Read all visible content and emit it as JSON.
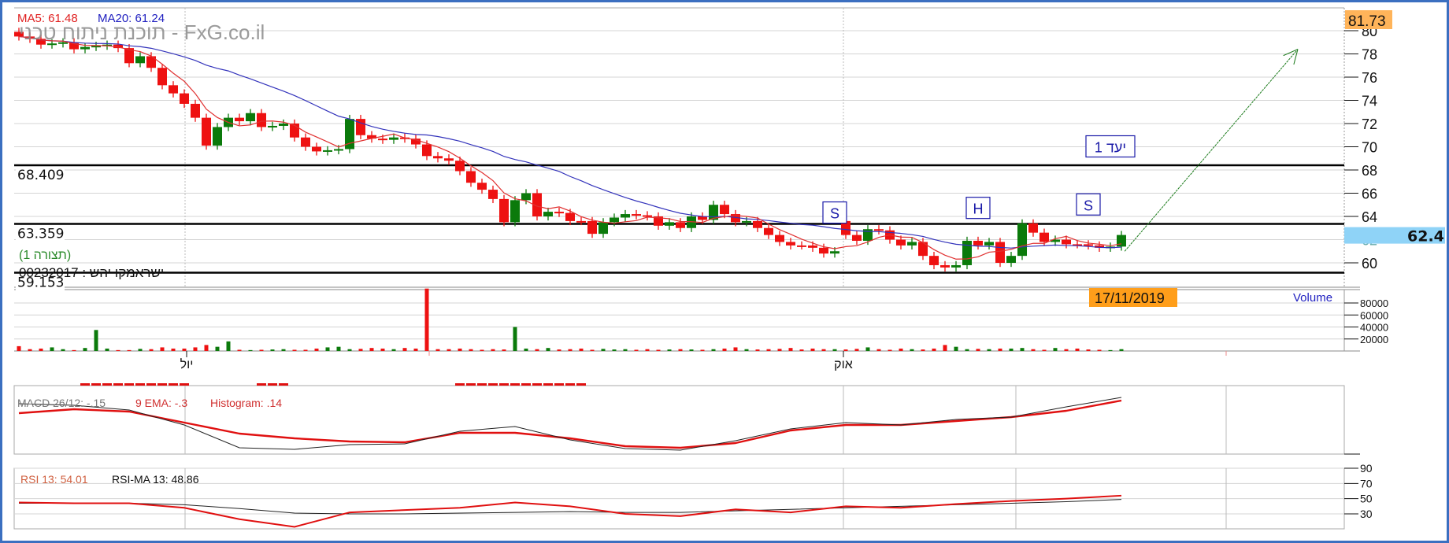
{
  "chart_data": {
    "type": "candlestick",
    "title_watermark": "תוכנת ניתוח טכני - FxG.co.il",
    "symbol_label": "ישראמקו יהש : 00232017",
    "pattern_label": "(תצורה 1)",
    "date_label": "17/11/2019",
    "ma_legend": {
      "ma5": "MA5: 61.48",
      "ma20": "MA20: 61.24"
    },
    "price_axis": {
      "ticks": [
        "80",
        "78",
        "76",
        "74",
        "72",
        "70",
        "68",
        "66",
        "64",
        "62",
        "60"
      ],
      "ylim": [
        58,
        82
      ]
    },
    "high_marker": "81.73",
    "last_price": "62.4",
    "levels": [
      {
        "value": 68.409,
        "label": "68.409"
      },
      {
        "value": 63.359,
        "label": "63.359"
      },
      {
        "value": 59.153,
        "label": "59.153"
      }
    ],
    "annotations": [
      {
        "text": "S",
        "index": 74,
        "price": 64.3
      },
      {
        "text": "H",
        "index": 87,
        "price": 64.7
      },
      {
        "text": "S",
        "index": 97,
        "price": 65.0
      },
      {
        "text": "יעד 1",
        "index": 99,
        "price": 70.0
      }
    ],
    "target_arrow": {
      "from": {
        "index": 100.3,
        "price": 61.0
      },
      "to": {
        "index": 116,
        "price": 78.4
      }
    },
    "x_labels": [
      {
        "text": "יול",
        "index": 15
      },
      {
        "text": "אוק",
        "index": 75
      }
    ],
    "open": [
      79.9,
      79.5,
      79.3,
      78.8,
      78.9,
      79.0,
      78.4,
      78.6,
      78.7,
      78.8,
      78.5,
      77.2,
      77.8,
      76.8,
      75.3,
      74.6,
      73.7,
      72.5,
      70.1,
      71.7,
      72.5,
      72.2,
      72.9,
      71.7,
      71.8,
      72.0,
      70.8,
      70.0,
      69.6,
      69.7,
      69.8,
      72.4,
      71.0,
      70.7,
      70.6,
      70.8,
      70.7,
      70.2,
      69.2,
      69.0,
      68.8,
      67.9,
      66.9,
      66.3,
      65.5,
      63.5,
      65.4,
      66.0,
      64.0,
      64.4,
      64.3,
      63.6,
      63.6,
      62.5,
      63.5,
      63.9,
      64.2,
      64.1,
      64.0,
      63.2,
      63.5,
      63.0,
      64.0,
      63.7,
      65.0,
      64.2,
      63.5,
      63.6,
      63.0,
      62.4,
      61.8,
      61.5,
      61.5,
      61.3,
      60.8,
      63.6,
      62.4,
      61.9,
      62.9,
      62.8,
      62.0,
      61.5,
      61.8,
      60.6,
      59.8,
      59.6,
      59.8,
      61.9,
      61.5,
      61.8,
      60.0,
      60.6,
      63.4,
      62.6,
      61.8,
      62.0,
      61.6,
      61.6,
      61.5,
      61.3,
      61.4
    ],
    "close": [
      79.5,
      79.3,
      78.8,
      78.9,
      79.0,
      78.4,
      78.6,
      78.7,
      78.8,
      78.5,
      77.2,
      77.8,
      76.8,
      75.3,
      74.6,
      73.7,
      72.5,
      70.1,
      71.7,
      72.5,
      72.2,
      72.9,
      71.7,
      71.8,
      72.0,
      70.8,
      70.0,
      69.6,
      69.7,
      69.8,
      72.4,
      71.0,
      70.7,
      70.6,
      70.8,
      70.7,
      70.2,
      69.2,
      69.0,
      68.8,
      67.9,
      66.9,
      66.3,
      65.5,
      63.5,
      65.4,
      66.0,
      64.0,
      64.4,
      64.3,
      63.6,
      63.6,
      62.5,
      63.5,
      63.9,
      64.2,
      64.1,
      64.0,
      63.2,
      63.5,
      63.0,
      64.0,
      63.7,
      65.0,
      64.2,
      63.5,
      63.6,
      63.0,
      62.4,
      61.8,
      61.5,
      61.5,
      61.3,
      60.8,
      61.0,
      62.4,
      61.9,
      62.9,
      62.8,
      62.0,
      61.5,
      61.8,
      60.6,
      59.8,
      59.6,
      59.8,
      61.9,
      61.5,
      61.8,
      60.0,
      60.6,
      63.4,
      62.6,
      61.8,
      62.0,
      61.6,
      61.6,
      61.5,
      61.3,
      61.4,
      62.4
    ],
    "volume": {
      "label": "Volume",
      "ticks": [
        "80000",
        "60000",
        "40000",
        "20000"
      ],
      "ylim": [
        0,
        105000
      ],
      "values": [
        8000,
        3000,
        4000,
        6000,
        3000,
        1500,
        5000,
        35000,
        4000,
        1500,
        1500,
        3500,
        3000,
        6000,
        4000,
        4000,
        6000,
        10000,
        7000,
        16000,
        2000,
        1500,
        2000,
        2500,
        3000,
        2000,
        2000,
        4000,
        6000,
        7000,
        3000,
        3500,
        5000,
        4000,
        3000,
        5000,
        4000,
        104000,
        3000,
        3000,
        4000,
        3000,
        2000,
        3000,
        2500,
        40000,
        4000,
        3000,
        5000,
        2500,
        3000,
        4000,
        2000,
        3500,
        2500,
        3000,
        2000,
        3000,
        2000,
        2500,
        3000,
        2500,
        2000,
        3000,
        4000,
        6000,
        3000,
        2500,
        3000,
        3500,
        5000,
        2500,
        4000,
        3000,
        3000,
        2500,
        3500,
        6000,
        3000,
        2000,
        4000,
        3000,
        2500,
        4000,
        10000,
        7000,
        3000,
        3500,
        3000,
        4000,
        4000,
        5000,
        3000,
        2000,
        5000,
        3000,
        4000,
        2500,
        2000,
        1500,
        3000
      ]
    },
    "macd": {
      "legend": {
        "macd": "MACD 26/12: -.15",
        "ema": "9 EMA: -.3",
        "hist": "Histogram: .14"
      },
      "sample_step": 5,
      "macd_line": [
        3.2,
        3.0,
        2.4,
        0.5,
        -2.4,
        -2.6,
        -2.0,
        -1.9,
        -0.3,
        0.3,
        -1.4,
        -2.5,
        -2.7,
        -1.5,
        0.0,
        0.8,
        0.5,
        1.2,
        1.5,
        2.8,
        4.0
      ],
      "signal_line": [
        2.0,
        2.5,
        2.2,
        0.8,
        -0.6,
        -1.2,
        -1.6,
        -1.7,
        -0.5,
        -0.5,
        -1.2,
        -2.2,
        -2.4,
        -1.8,
        -0.2,
        0.5,
        0.5,
        1.0,
        1.5,
        2.3,
        3.6
      ],
      "histogram": [
        0,
        0,
        0,
        0,
        0,
        0,
        -1,
        -1,
        -1,
        -1,
        -1,
        -1,
        -1,
        -1,
        -1,
        -1,
        0,
        0,
        0,
        0,
        0,
        0,
        -1,
        -1,
        -1,
        0,
        0,
        0,
        0,
        0,
        0,
        0,
        0,
        0,
        0,
        0,
        0,
        0,
        0,
        0,
        -1,
        -1,
        -1,
        -1,
        -1,
        -1,
        -1,
        -1,
        -1,
        -1,
        -1,
        -1,
        0,
        0,
        0,
        0,
        0,
        0,
        0,
        0,
        0,
        0,
        0,
        0,
        0,
        0,
        0,
        0,
        0,
        0,
        0,
        0,
        0,
        0,
        0,
        0,
        0,
        0,
        0,
        0,
        0,
        0,
        0,
        0,
        0,
        0,
        0,
        0,
        0,
        0,
        0,
        0,
        0,
        0,
        0,
        0,
        0,
        0,
        0,
        0,
        0
      ]
    },
    "rsi": {
      "legend": {
        "rsi": "RSI 13: 54.01",
        "ma": "RSI-MA 13: 48.86"
      },
      "ticks": [
        "90",
        "70",
        "50",
        "30"
      ],
      "ylim": [
        10,
        90
      ],
      "sample_step": 5,
      "rsi_line": [
        45,
        44,
        44,
        38,
        23,
        13,
        32,
        35,
        38,
        45,
        40,
        30,
        27,
        36,
        32,
        40,
        38,
        43,
        47,
        50,
        54
      ],
      "rsi_ma": [
        44,
        44,
        44,
        42,
        37,
        31,
        30,
        30,
        31,
        32,
        33,
        32,
        32,
        34,
        36,
        38,
        40,
        42,
        44,
        46,
        49
      ]
    },
    "colors": {
      "up": "#0b7a0b",
      "down": "#ee1111",
      "ma5": "#e03030",
      "ma20": "#3333bb",
      "orange": "#ff9e1a",
      "last": "#8fd3f7",
      "annot": "#1a1aa8",
      "frame": "#3b6fc0"
    }
  }
}
